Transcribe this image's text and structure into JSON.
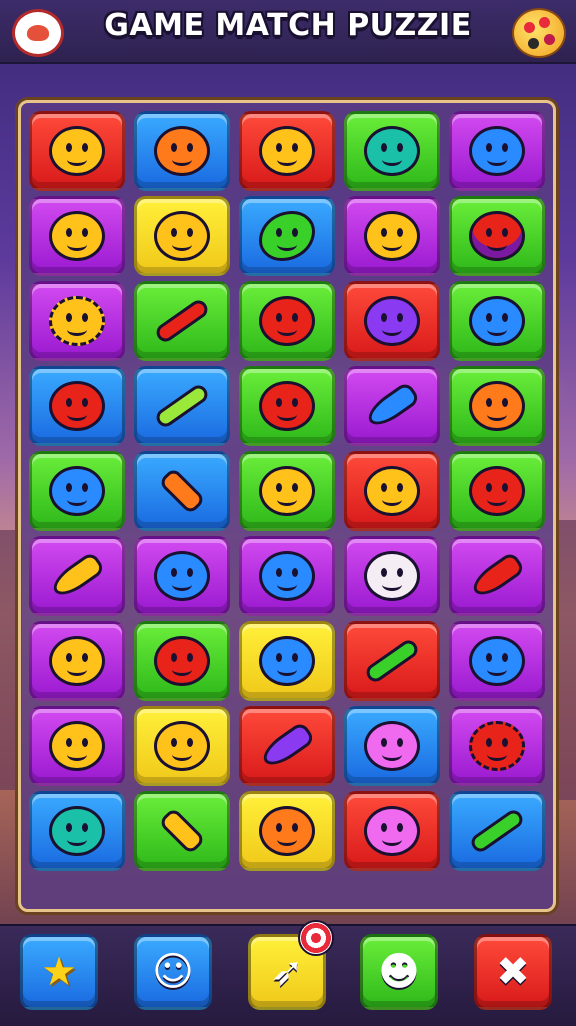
{
  "header": {
    "title": "GAME MATCH PUZZIE",
    "logo_icon": "red-blob-logo-icon",
    "palette_icon": "palette-icon"
  },
  "board": {
    "rows": [
      [
        [
          "red",
          "c-yellow",
          "smiley"
        ],
        [
          "blue",
          "c-orange",
          "smiley"
        ],
        [
          "red",
          "c-yellow",
          "smiley"
        ],
        [
          "green",
          "c-teal",
          "smiley"
        ],
        [
          "purple",
          "c-blue",
          "smiley"
        ]
      ],
      [
        [
          "purple",
          "c-yellow",
          "smiley"
        ],
        [
          "yellow",
          "c-yellow",
          "smiley"
        ],
        [
          "blue",
          "c-green",
          "fish"
        ],
        [
          "purple",
          "c-yellow",
          "smiley"
        ],
        [
          "green",
          "c-red",
          "planet"
        ]
      ],
      [
        [
          "purple",
          "c-yellow",
          "spiky"
        ],
        [
          "green",
          "c-red",
          "cross"
        ],
        [
          "green",
          "c-red",
          "smiley"
        ],
        [
          "red",
          "c-purple",
          "smiley"
        ],
        [
          "green",
          "c-blue",
          "smiley"
        ]
      ],
      [
        [
          "blue",
          "c-red",
          "smiley"
        ],
        [
          "blue",
          "c-lime",
          "cross"
        ],
        [
          "green",
          "c-red",
          "smiley"
        ],
        [
          "purple",
          "c-blue",
          "rocket"
        ],
        [
          "green",
          "c-orange",
          "smiley"
        ]
      ],
      [
        [
          "green",
          "c-blue",
          "smiley"
        ],
        [
          "blue",
          "c-orange",
          "pop"
        ],
        [
          "green",
          "c-yellow",
          "smiley"
        ],
        [
          "red",
          "c-yellow",
          "smiley"
        ],
        [
          "green",
          "c-red",
          "smiley"
        ]
      ],
      [
        [
          "purple",
          "c-yellow",
          "cone"
        ],
        [
          "purple",
          "c-blue",
          "smiley"
        ],
        [
          "purple",
          "c-blue",
          "smiley"
        ],
        [
          "purple",
          "c-white",
          "smiley"
        ],
        [
          "purple",
          "c-red",
          "cone"
        ]
      ],
      [
        [
          "purple",
          "c-yellow",
          "smiley"
        ],
        [
          "green",
          "c-red",
          "smiley"
        ],
        [
          "yellow",
          "c-blue",
          "smiley"
        ],
        [
          "red",
          "c-green",
          "cross"
        ],
        [
          "purple",
          "c-blue",
          "smiley"
        ]
      ],
      [
        [
          "purple",
          "c-yellow",
          "smiley"
        ],
        [
          "yellow",
          "c-yellow",
          "smiley"
        ],
        [
          "red",
          "c-purple",
          "rocket"
        ],
        [
          "blue",
          "c-pink",
          "smiley"
        ],
        [
          "purple",
          "c-red",
          "spiky"
        ]
      ],
      [
        [
          "blue",
          "c-teal",
          "smiley"
        ],
        [
          "green",
          "c-yellow",
          "pop"
        ],
        [
          "yellow",
          "c-orange",
          "smiley"
        ],
        [
          "red",
          "c-pink",
          "smiley"
        ],
        [
          "blue",
          "c-green",
          "cross"
        ]
      ]
    ]
  },
  "powerups": [
    {
      "name": "star-powerup-button",
      "color": "blue",
      "icon": "star-icon",
      "glyph": "★"
    },
    {
      "name": "smiley-powerup-button",
      "color": "blue",
      "icon": "smiley-icon",
      "glyph": "☺"
    },
    {
      "name": "rocket-powerup-button",
      "color": "yellow",
      "icon": "rocket-icon",
      "glyph": "➶"
    },
    {
      "name": "face-powerup-button",
      "color": "green",
      "icon": "face-icon",
      "glyph": "☻"
    },
    {
      "name": "x-powerup-button",
      "color": "red",
      "icon": "close-icon",
      "glyph": "✖"
    }
  ]
}
